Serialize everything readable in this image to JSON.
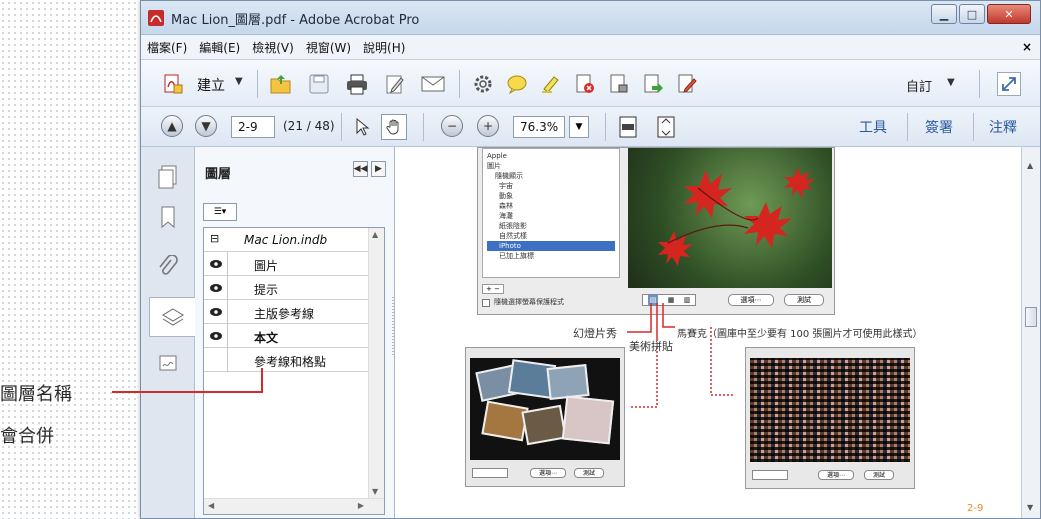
{
  "window": {
    "title": "Mac Lion_圖層.pdf - Adobe Acrobat Pro"
  },
  "menu": [
    "檔案(F)",
    "編輯(E)",
    "檢視(V)",
    "視窗(W)",
    "說明(H)"
  ],
  "menu_close": "×",
  "toolbar": {
    "create_label": "建立",
    "customize_label": "自訂"
  },
  "nav": {
    "page_value": "2-9",
    "page_count": "(21 / 48)",
    "zoom_value": "76.3%",
    "tools": "工具",
    "sign": "簽署",
    "comment": "注釋"
  },
  "layers_panel": {
    "title": "圖層",
    "root": "Mac Lion.indb",
    "layers": [
      {
        "name": "圖片",
        "visible": true,
        "bold": false
      },
      {
        "name": "提示",
        "visible": true,
        "bold": false
      },
      {
        "name": "主版參考線",
        "visible": true,
        "bold": false
      },
      {
        "name": "本文",
        "visible": true,
        "bold": true
      },
      {
        "name": "參考線和格點",
        "visible": false,
        "bold": false
      }
    ]
  },
  "annotation": {
    "line1": "圖層名稱",
    "line2": "會合併"
  },
  "document": {
    "tree_items": [
      "Apple",
      "圖片",
      "隨機顯示",
      "宇宙",
      "動象",
      "森林",
      "海灘",
      "紙張陰影",
      "自然式樣",
      "iPhoto",
      "已加上旗標"
    ],
    "dialog_btn1": "選項⋯",
    "dialog_btn2": "測試",
    "checkbox_label": "隨機選擇螢幕保護程式",
    "caption_slideshow": "幻燈片秀",
    "caption_collage": "美術拼貼",
    "caption_mosaic": "馬賽克（圖庫中至少要有 100 張圖片才可使用此樣式）",
    "page_number": "2-9"
  }
}
